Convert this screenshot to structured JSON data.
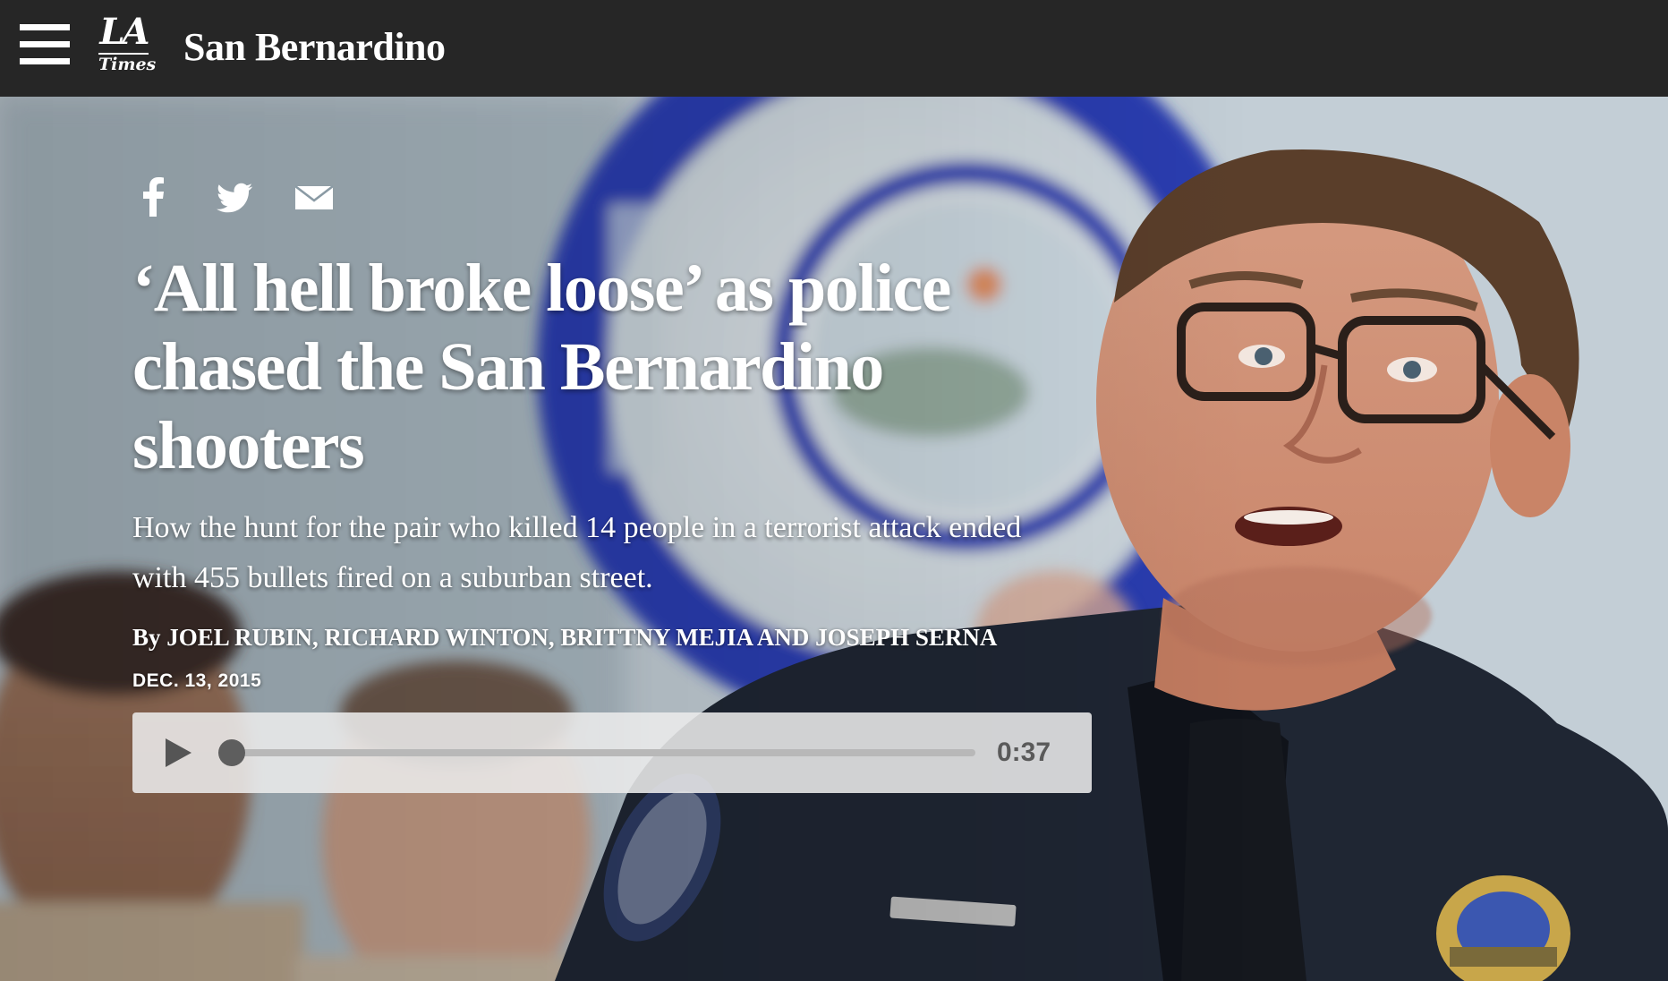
{
  "header": {
    "menu_icon": "hamburger-menu-icon",
    "logo": {
      "line1": "LA",
      "line2": "Times"
    },
    "section_title": "San Bernardino",
    "background": "#262626"
  },
  "hero": {
    "description_colors": {
      "sky": "#c9d4dc",
      "seal_blue": "#2233aa",
      "uniform": "#1f2633"
    }
  },
  "share": {
    "icons": [
      "facebook-icon",
      "twitter-icon",
      "email-icon"
    ]
  },
  "article": {
    "headline": "‘All hell broke loose’ as police chased the San Bernardino shooters",
    "dek": "How the hunt for the pair who killed 14 people in a terrorist attack ended with 455 bullets fired on a suburban street.",
    "byline": "By JOEL RUBIN, RICHARD WINTON, BRITTNY MEJIA AND JOSEPH SERNA",
    "date": "DEC. 13, 2015"
  },
  "audio": {
    "play_icon": "play-icon",
    "duration": "0:37",
    "progress": 0.0
  }
}
